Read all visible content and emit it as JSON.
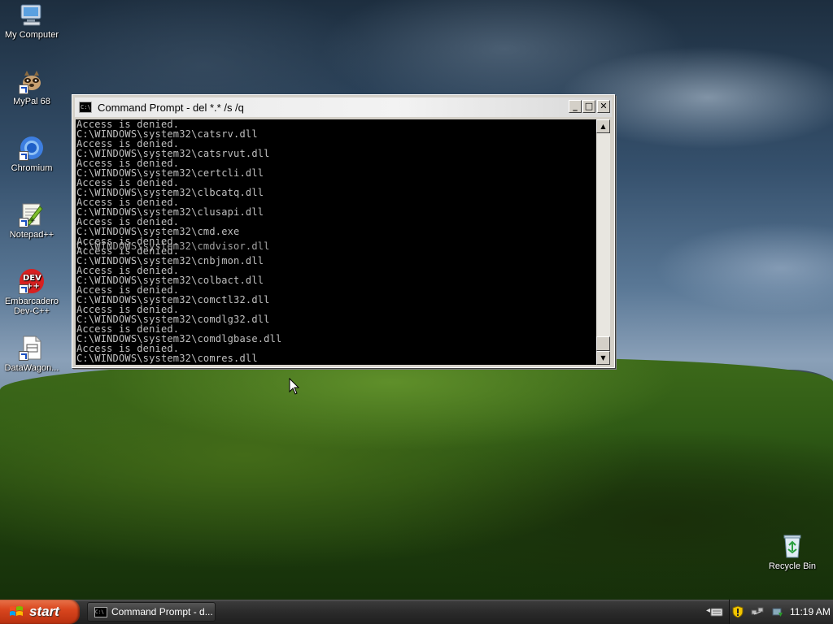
{
  "desktop": {
    "icons": [
      {
        "label": "My Computer",
        "icon": "my-computer-icon",
        "shortcut": false
      },
      {
        "label": "MyPal 68",
        "icon": "mypal-icon",
        "shortcut": true
      },
      {
        "label": "Chromium",
        "icon": "chromium-icon",
        "shortcut": true
      },
      {
        "label": "Notepad++",
        "icon": "notepad-plus-plus-icon",
        "shortcut": true
      },
      {
        "label": "Embarcadero Dev-C++",
        "icon": "devcpp-icon",
        "shortcut": true
      },
      {
        "label": "DataWagon...",
        "icon": "datawagon-icon",
        "shortcut": true
      },
      {
        "label": "Recycle Bin",
        "icon": "recycle-bin-icon",
        "shortcut": false
      }
    ]
  },
  "window": {
    "title": "Command Prompt - del *.* /s /q",
    "minimize_symbol": "_",
    "maximize_symbol": "□",
    "close_symbol": "✕",
    "icon_text": "C:\\",
    "console_lines": [
      "Access is denied.",
      "C:\\WINDOWS\\system32\\catsrv.dll",
      "Access is denied.",
      "C:\\WINDOWS\\system32\\catsrvut.dll",
      "Access is denied.",
      "C:\\WINDOWS\\system32\\certcli.dll",
      "Access is denied.",
      "C:\\WINDOWS\\system32\\clbcatq.dll",
      "Access is denied.",
      "C:\\WINDOWS\\system32\\clusapi.dll",
      "Access is denied.",
      "C:\\WINDOWS\\system32\\cmd.exe",
      "Access is denied.",
      "Access is denied.",
      "C:\\WINDOWS\\system32\\cnbjmon.dll",
      "Access is denied.",
      "C:\\WINDOWS\\system32\\colbact.dll",
      "Access is denied.",
      "C:\\WINDOWS\\system32\\comctl32.dll",
      "Access is denied.",
      "C:\\WINDOWS\\system32\\comdlg32.dll",
      "Access is denied.",
      "C:\\WINDOWS\\system32\\comdlgbase.dll",
      "Access is denied.",
      "C:\\WINDOWS\\system32\\comres.dll"
    ],
    "glitch_line_index": 13,
    "glitch_overlay": "C:\\WINDOWS\\system32\\cmdvisor.dll",
    "scroll_up_symbol": "▲",
    "scroll_down_symbol": "▼"
  },
  "taskbar": {
    "start_label": "start",
    "task_button_label": "Command Prompt - d...",
    "tray_toggle_symbol": "◂",
    "tray_icons": [
      "keyboard-icon",
      "security-shield-icon",
      "network-icon",
      "safely-remove-icon"
    ],
    "clock": "11:19 AM"
  },
  "colors": {
    "console_bg": "#000000",
    "console_text": "#c0c0c0",
    "start_button": "#d9461e"
  }
}
